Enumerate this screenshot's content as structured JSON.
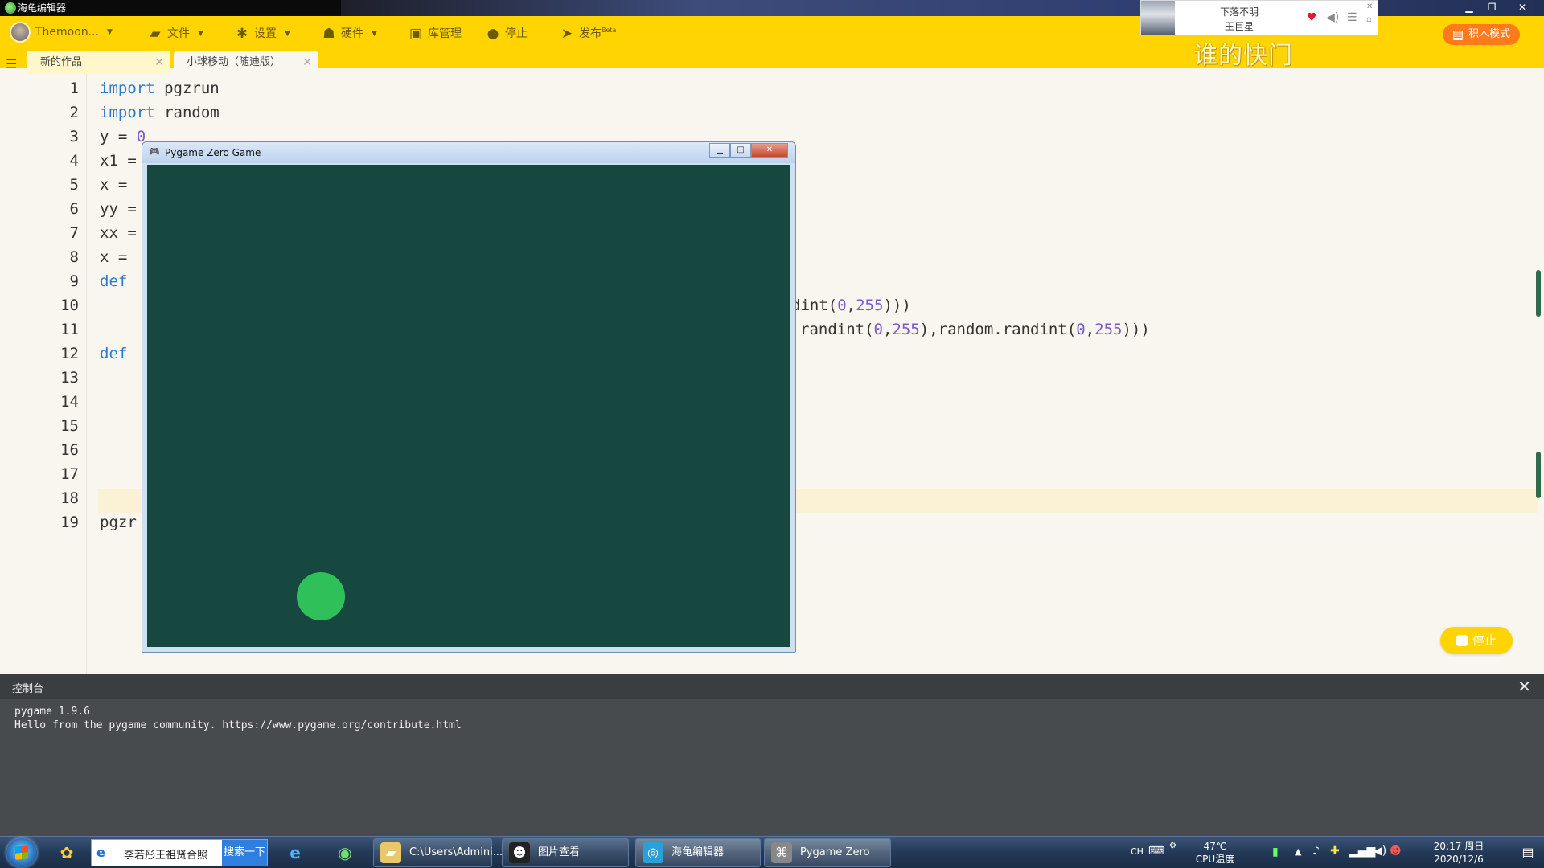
{
  "os_window": {
    "title": "海龟编辑器"
  },
  "toolbar": {
    "user_name": "Themoon...",
    "file_label": "文件",
    "settings_label": "设置",
    "hardware_label": "硬件",
    "library_label": "库管理",
    "stop_label": "停止",
    "publish_label": "发布",
    "publish_badge": "Beta",
    "blocks_mode_label": "积木模式"
  },
  "music_widget": {
    "song": "下落不明",
    "artist": "王巨星",
    "lyric": "谁的快门"
  },
  "tabs": [
    {
      "label": "新的作品"
    },
    {
      "label": "小球移动（随迪版）"
    }
  ],
  "editor": {
    "line_numbers": [
      "1",
      "2",
      "3",
      "4",
      "5",
      "6",
      "7",
      "8",
      "9",
      "10",
      "11",
      "12",
      "13",
      "14",
      "15",
      "16",
      "17",
      "18",
      "19"
    ],
    "lines": {
      "l1_kw": "import",
      "l1_rest": " pgzrun",
      "l2_kw": "import",
      "l2_rest": " random",
      "l3_a": "y = ",
      "l3_num": "0",
      "l4": "x1 =",
      "l5": "x = ",
      "l6": "yy =",
      "l7": "xx =",
      "l8": "x = ",
      "l9_kw": "def",
      "l10_a": "dint(",
      "l10_n1": "0",
      "l10_b": ",",
      "l10_n2": "255",
      "l10_c": ")))",
      "l11_a": "randint(",
      "l11_n1": "0",
      "l11_b": ",",
      "l11_n2": "255",
      "l11_c": "),random.randint(",
      "l11_n3": "0",
      "l11_d": ",",
      "l11_n4": "255",
      "l11_e": ")))",
      "l12_kw": "def",
      "l19": "pgzr"
    },
    "stop_button_label": "停止"
  },
  "pygame_window": {
    "title": "Pygame Zero Game",
    "background_color": "#164840",
    "ball_color": "#2fc05a"
  },
  "console": {
    "title": "控制台",
    "lines": [
      "pygame 1.9.6",
      "Hello from the pygame community. https://www.pygame.org/contribute.html"
    ]
  },
  "taskbar": {
    "ie_search_text": "李若彤王祖贤合照",
    "ie_search_button": "搜索一下",
    "tasks": [
      {
        "label": "C:\\Users\\Admini..."
      },
      {
        "label": "图片查看"
      },
      {
        "label": "海龟编辑器"
      },
      {
        "label": "Pygame Zero G..."
      }
    ],
    "tray": {
      "lang": "CH",
      "cpu_temp": "47℃",
      "cpu_label": "CPU温度",
      "time": "20:17 周日",
      "date": "2020/12/6"
    }
  }
}
